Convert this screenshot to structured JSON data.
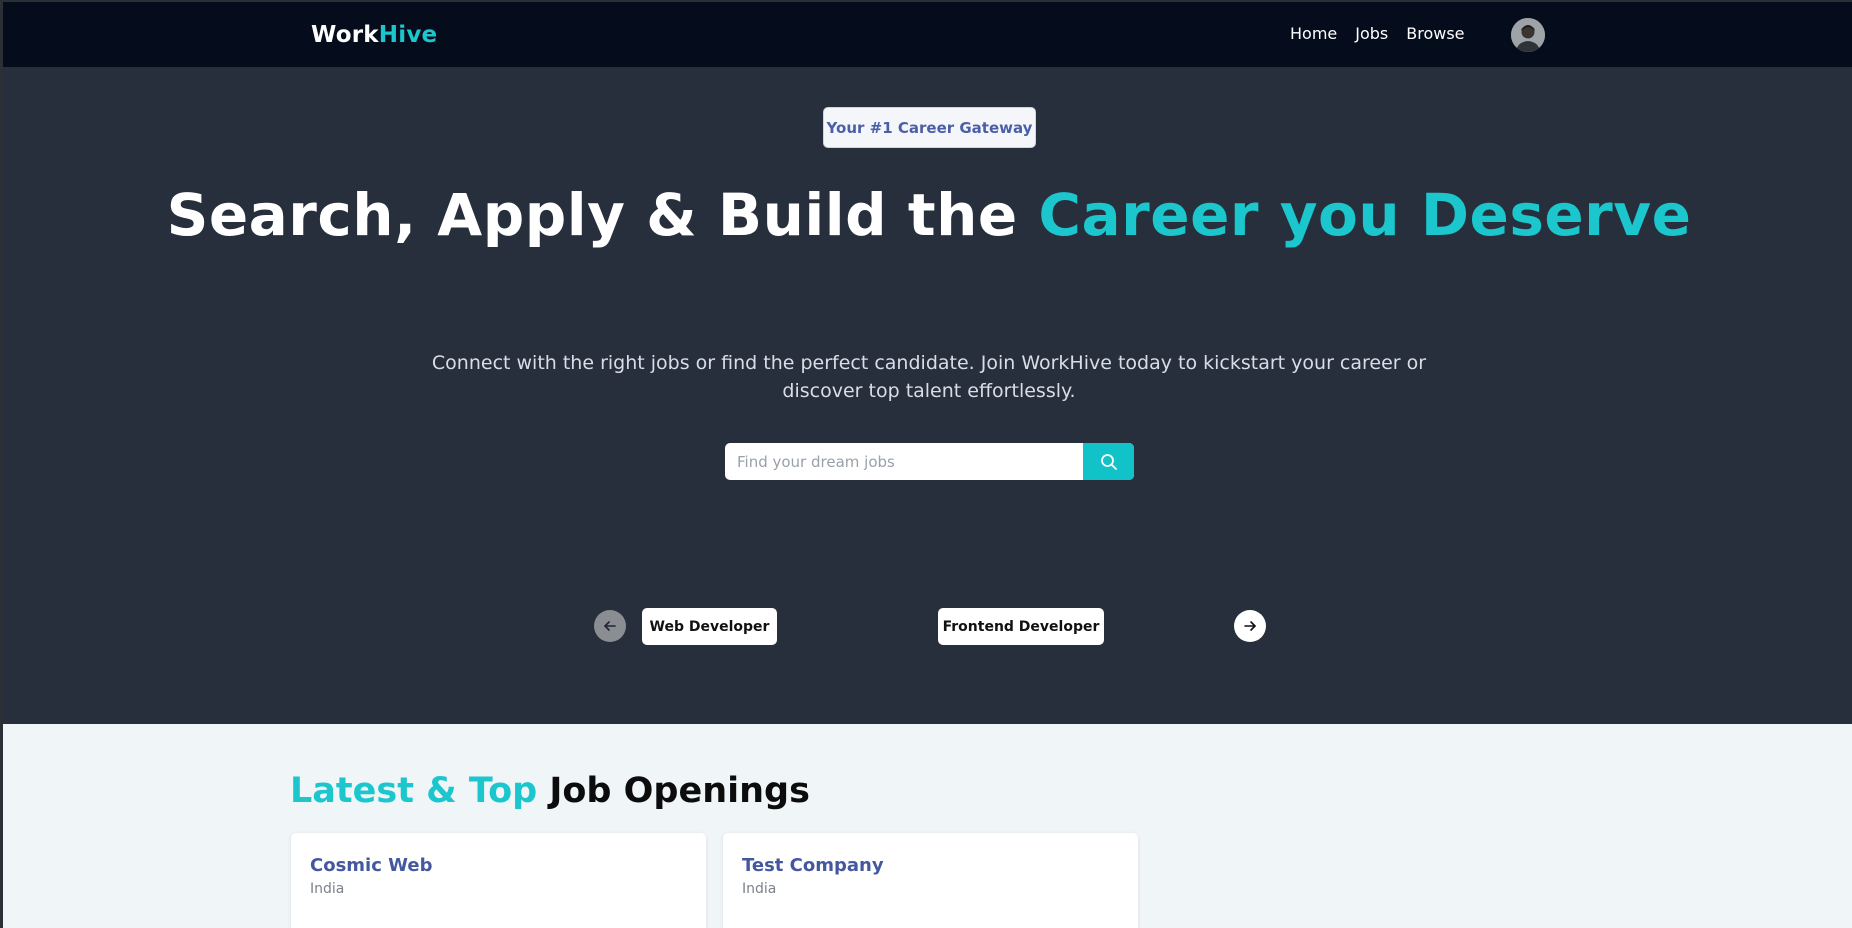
{
  "navbar": {
    "logo_primary": "Work",
    "logo_accent": "Hive",
    "links": [
      {
        "label": "Home"
      },
      {
        "label": "Jobs"
      },
      {
        "label": "Browse"
      }
    ]
  },
  "hero": {
    "badge": "Your #1 Career Gateway",
    "title_main": "Search, Apply & Build the",
    "title_accent": "Career you Deserve",
    "subtitle": "Connect with the right jobs or find the perfect candidate. Join WorkHive today to kickstart your career or discover top talent effortlessly.",
    "search": {
      "placeholder": "Find your dream jobs",
      "value": ""
    },
    "carousel": {
      "chips": [
        {
          "label": "Web Developer"
        },
        {
          "label": "Frontend Developer"
        }
      ]
    }
  },
  "jobs_section": {
    "heading_accent": "Latest & Top",
    "heading_main": "Job Openings",
    "cards": [
      {
        "company": "Cosmic Web",
        "location": "India"
      },
      {
        "company": "Test Company",
        "location": "India"
      }
    ]
  },
  "colors": {
    "accent": "#1bc6cd",
    "navbar_bg": "#050c1b",
    "hero_bg": "#272f3c",
    "section_bg": "#f0f5f8",
    "company_link": "#44589f"
  },
  "icons": {
    "search": "search-icon",
    "prev": "arrow-left-icon",
    "next": "arrow-right-icon",
    "avatar": "user-avatar"
  }
}
